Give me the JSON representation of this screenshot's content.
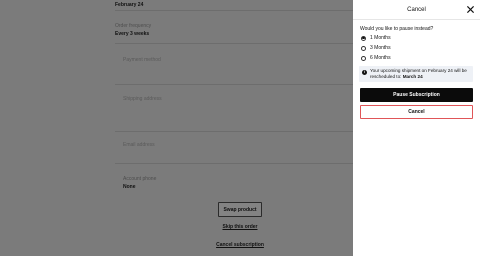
{
  "background": {
    "delivery_date_value": "February 24",
    "order_frequency_label": "Order frequency",
    "order_frequency_value": "Every 3 weeks",
    "payment_method_label": "Payment method",
    "shipping_address_label": "Shipping address",
    "email_address_label": "Email address",
    "account_phone_label": "Account phone",
    "account_phone_value": "None",
    "swap_label": "Swap product",
    "skip_label": "Skip this order",
    "cancel_subscription_label": "Cancel subscription"
  },
  "panel": {
    "title": "Cancel",
    "close_icon": "close-icon",
    "question": "Would you like to pause instead?",
    "options": [
      {
        "label": "1 Months",
        "selected": true
      },
      {
        "label": "3 Months",
        "selected": false
      },
      {
        "label": "6 Months",
        "selected": false
      }
    ],
    "info_text": "Your upcoming shipment on February 24 will be rescheduled to:",
    "info_date": "March 24",
    "pause_label": "Pause Subscription",
    "cancel_label": "Cancel"
  },
  "colors": {
    "overlay": "#7b7b7b",
    "primary": "#0b0b0b",
    "focus_ring": "#e05558",
    "info_bg": "#eef1f6"
  }
}
